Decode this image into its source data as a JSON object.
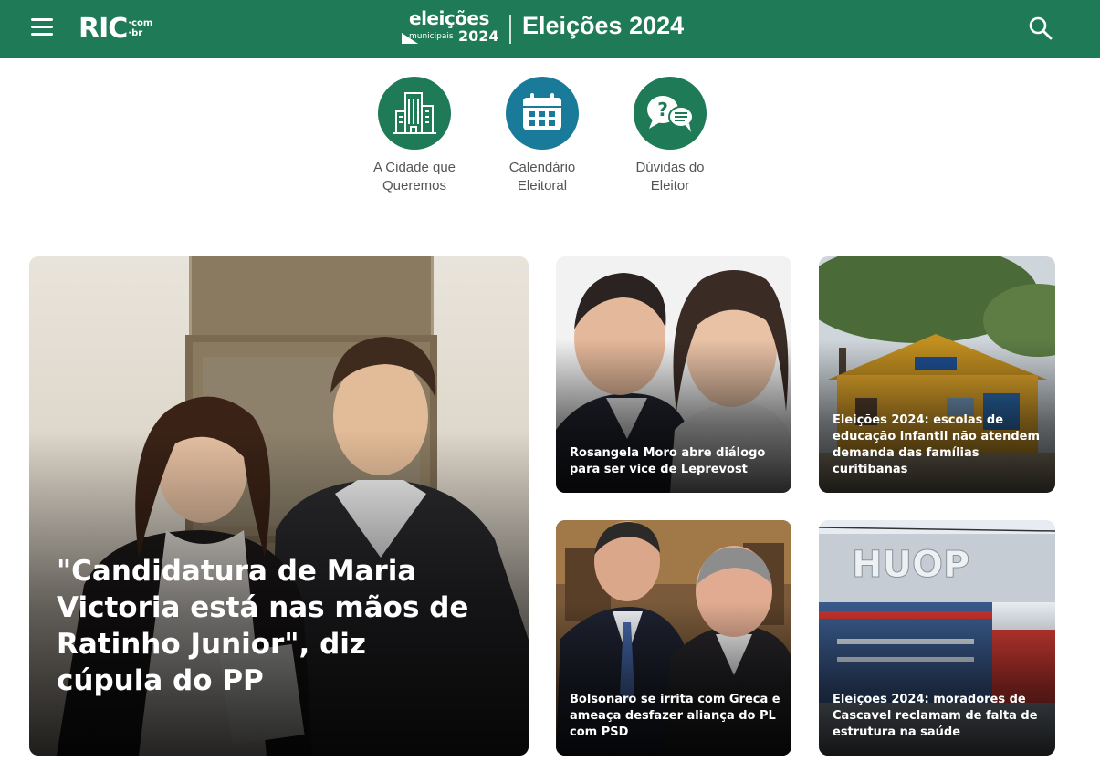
{
  "header": {
    "logo_main": "RIC",
    "logo_com": "·com",
    "logo_br": "·br",
    "brand_word": "eleições",
    "brand_sub": "municipais",
    "brand_year": "2024",
    "title": "Eleições 2024",
    "accent_color": "#1f7a57"
  },
  "quick_links": [
    {
      "label_line1": "A Cidade que",
      "label_line2": "Queremos",
      "icon": "buildings-icon",
      "color": "#1f7a57"
    },
    {
      "label_line1": "Calendário",
      "label_line2": "Eleitoral",
      "icon": "calendar-icon",
      "color": "#1a7a99"
    },
    {
      "label_line1": "Dúvidas do",
      "label_line2": "Eleitor",
      "icon": "question-chat-icon",
      "color": "#1f7a57"
    }
  ],
  "featured": {
    "title": "\"Candidatura de Maria Victoria está nas mãos de Ratinho Junior\", diz cúpula do PP"
  },
  "news": [
    {
      "title": "Rosangela Moro abre diálogo para ser vice de Leprevost"
    },
    {
      "title": "Eleições 2024: escolas de educação infantil não atendem demanda das famílias curitibanas"
    },
    {
      "title": "Bolsonaro se irrita com Greca e ameaça desfazer aliança do PL com PSD"
    },
    {
      "title": "Eleições 2024: moradores de Cascavel reclamam de falta de estrutura na saúde"
    }
  ]
}
